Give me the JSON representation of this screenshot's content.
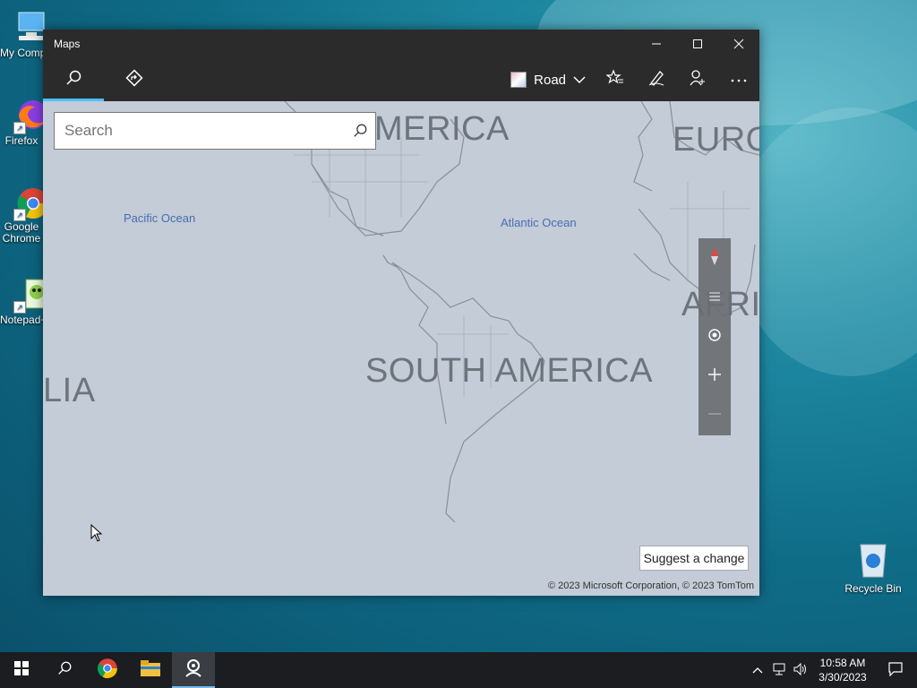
{
  "desktop": {
    "icons": [
      {
        "label": "My Computer"
      },
      {
        "label": "Firefox"
      },
      {
        "label": "Google Chrome"
      },
      {
        "label": "Notepad++"
      }
    ],
    "recycle_bin": "Recycle Bin"
  },
  "window": {
    "title": "Maps",
    "toolbar": {
      "map_style": "Road"
    },
    "search": {
      "placeholder": "Search",
      "value": ""
    },
    "map": {
      "labels": {
        "north_america": "MERICA",
        "europe": "EURO",
        "africa": "AFRI",
        "south_america": "SOUTH AMERICA",
        "australia": "LIA",
        "pacific": "Pacific Ocean",
        "atlantic": "Atlantic Ocean"
      }
    },
    "suggest_label": "Suggest a change",
    "copyright": "© 2023 Microsoft Corporation, © 2023 TomTom"
  },
  "taskbar": {
    "time": "10:58 AM",
    "date": "3/30/2023"
  },
  "colors": {
    "accent": "#4cc2ff",
    "titlebar": "#2b2b2b",
    "map_bg": "#c3ccd7"
  }
}
